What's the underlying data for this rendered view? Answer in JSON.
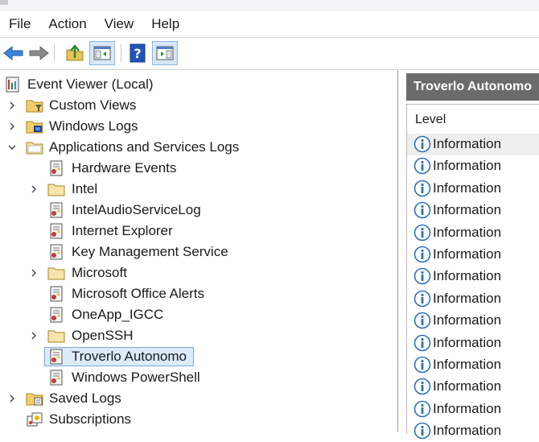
{
  "menu": [
    "File",
    "Action",
    "View",
    "Help"
  ],
  "toolbar": {
    "buttons": [
      "back-arrow-icon",
      "forward-arrow-icon",
      "up-folder-icon",
      "show-hide-console-tree-icon",
      "help-icon",
      "show-hide-action-pane-icon"
    ]
  },
  "tree": {
    "items": [
      {
        "label": "Event Viewer (Local)",
        "icon": "event-viewer-icon",
        "expander": "none",
        "level": 0
      },
      {
        "label": "Custom Views",
        "icon": "filter-folder-icon",
        "expander": "collapsed",
        "level": 1
      },
      {
        "label": "Windows Logs",
        "icon": "windows-folder-icon",
        "expander": "collapsed",
        "level": 1
      },
      {
        "label": "Applications and Services Logs",
        "icon": "folder-open-icon",
        "expander": "expanded",
        "level": 1
      },
      {
        "label": "Hardware Events",
        "icon": "log-icon",
        "expander": "none",
        "level": 2
      },
      {
        "label": "Intel",
        "icon": "folder-icon",
        "expander": "collapsed",
        "level": 2
      },
      {
        "label": "IntelAudioServiceLog",
        "icon": "log-icon",
        "expander": "none",
        "level": 2
      },
      {
        "label": "Internet Explorer",
        "icon": "log-icon",
        "expander": "none",
        "level": 2
      },
      {
        "label": "Key Management Service",
        "icon": "log-icon",
        "expander": "none",
        "level": 2
      },
      {
        "label": "Microsoft",
        "icon": "folder-icon",
        "expander": "collapsed",
        "level": 2
      },
      {
        "label": "Microsoft Office Alerts",
        "icon": "log-icon",
        "expander": "none",
        "level": 2
      },
      {
        "label": "OneApp_IGCC",
        "icon": "log-icon",
        "expander": "none",
        "level": 2
      },
      {
        "label": "OpenSSH",
        "icon": "folder-icon",
        "expander": "collapsed",
        "level": 2
      },
      {
        "label": "Troverlo Autonomo",
        "icon": "log-icon",
        "expander": "none",
        "level": 2,
        "selected": true
      },
      {
        "label": "Windows PowerShell",
        "icon": "log-icon",
        "expander": "none",
        "level": 2
      },
      {
        "label": "Saved Logs",
        "icon": "saved-folder-icon",
        "expander": "collapsed",
        "level": 1
      },
      {
        "label": "Subscriptions",
        "icon": "subscriptions-icon",
        "expander": "none",
        "level": 1
      }
    ]
  },
  "panel": {
    "title": "Troverlo Autonomo",
    "column_header": "Level",
    "rows": [
      "Information",
      "Information",
      "Information",
      "Information",
      "Information",
      "Information",
      "Information",
      "Information",
      "Information",
      "Information",
      "Information",
      "Information",
      "Information",
      "Information"
    ],
    "highlighted_row": 0
  },
  "colors": {
    "panel_header_bg": "#6b6b6b",
    "selection_bg": "#dcebfb",
    "selection_border": "#7aa8dc",
    "info_icon_blue": "#2f6fbd"
  }
}
